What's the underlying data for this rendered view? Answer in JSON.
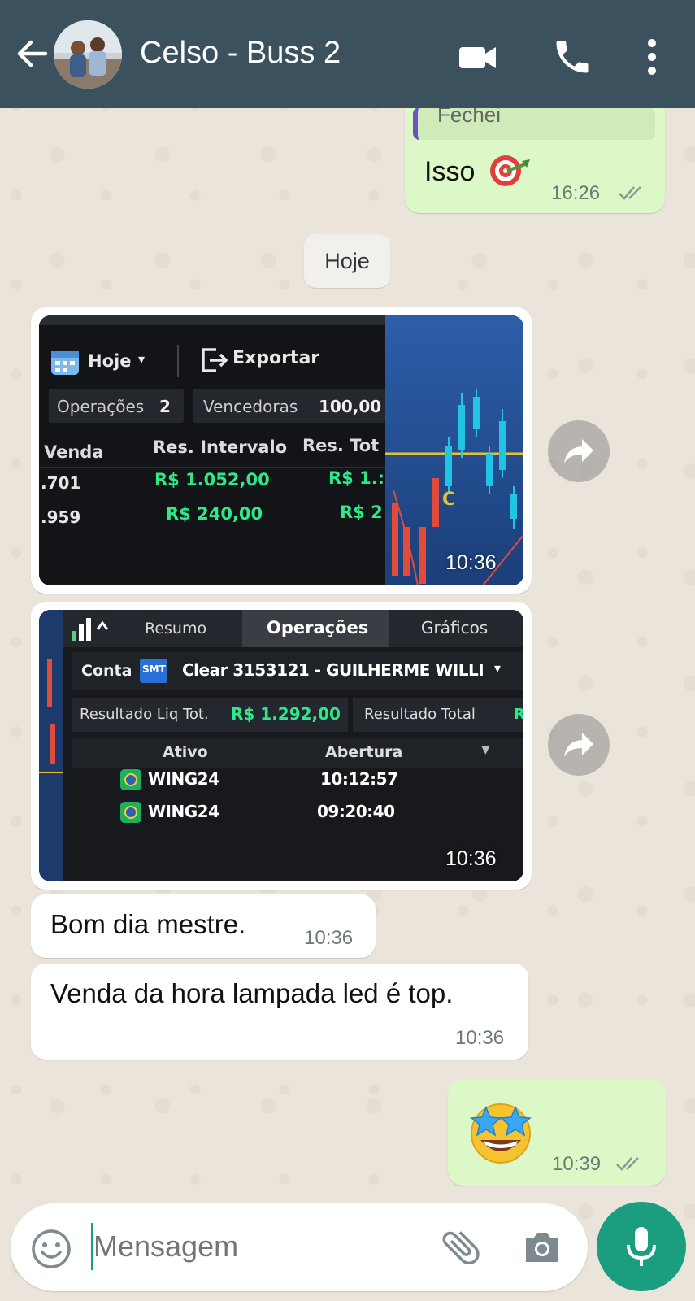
{
  "header": {
    "contact_name": "Celso - Buss 2",
    "icons": [
      "back-arrow-icon",
      "video-call-icon",
      "phone-icon",
      "more-vert-icon"
    ],
    "background": "#3b515e"
  },
  "messages": {
    "top_out": {
      "quoted_text": "Fechei",
      "text": "Isso",
      "emoji": "direct-hit-emoji",
      "time": "16:26",
      "status": "read-double-check"
    },
    "date_chip": "Hoje",
    "photo1": {
      "time": "10:36",
      "toolbar": {
        "period": "Hoje",
        "export": "Exportar"
      },
      "stats": {
        "ops_label": "Operações",
        "ops_value": "2",
        "win_label": "Vencedoras",
        "win_value": "100,00"
      },
      "columns": [
        "Venda",
        "Res. Intervalo",
        "Res. Tot"
      ],
      "rows": [
        {
          "venda": ".701",
          "res_intervalo": "R$ 1.052,00",
          "res_tot": "R$ 1.:"
        },
        {
          "venda": ".959",
          "res_intervalo": "R$ 240,00",
          "res_tot": "R$ 2"
        }
      ],
      "chart_marker": "C"
    },
    "photo2": {
      "time": "10:36",
      "tabs": [
        "Resumo",
        "Operações",
        "Gráficos"
      ],
      "account_label": "Conta",
      "account_badge": "SMT",
      "account_value": "Clear 3153121 - GUILHERME WILLI",
      "result_label": "Resultado Liq Tot.",
      "result_value": "R$ 1.292,00",
      "result_total_label": "Resultado Total",
      "result_total_cut": "R",
      "table_headers": [
        "Ativo",
        "Abertura"
      ],
      "rows": [
        {
          "ativo": "WING24",
          "abertura": "10:12:57"
        },
        {
          "ativo": "WING24",
          "abertura": "09:20:40"
        }
      ]
    },
    "msg_bom_dia": {
      "text": "Bom dia mestre.",
      "time": "10:36"
    },
    "msg_venda": {
      "text": "Venda da hora lampada led é top.",
      "time": "10:36"
    },
    "emoji_out": {
      "emoji": "star-struck-emoji",
      "time": "10:39",
      "status": "read-double-check"
    }
  },
  "input": {
    "placeholder": "Mensagem",
    "icons": [
      "emoji-icon",
      "attach-icon",
      "camera-icon",
      "mic-icon"
    ]
  },
  "colors": {
    "outgoing_bubble": "#dcf8c6",
    "incoming_bubble": "#ffffff",
    "accent": "#1a9e7f",
    "profit_green": "#2ee88a"
  }
}
